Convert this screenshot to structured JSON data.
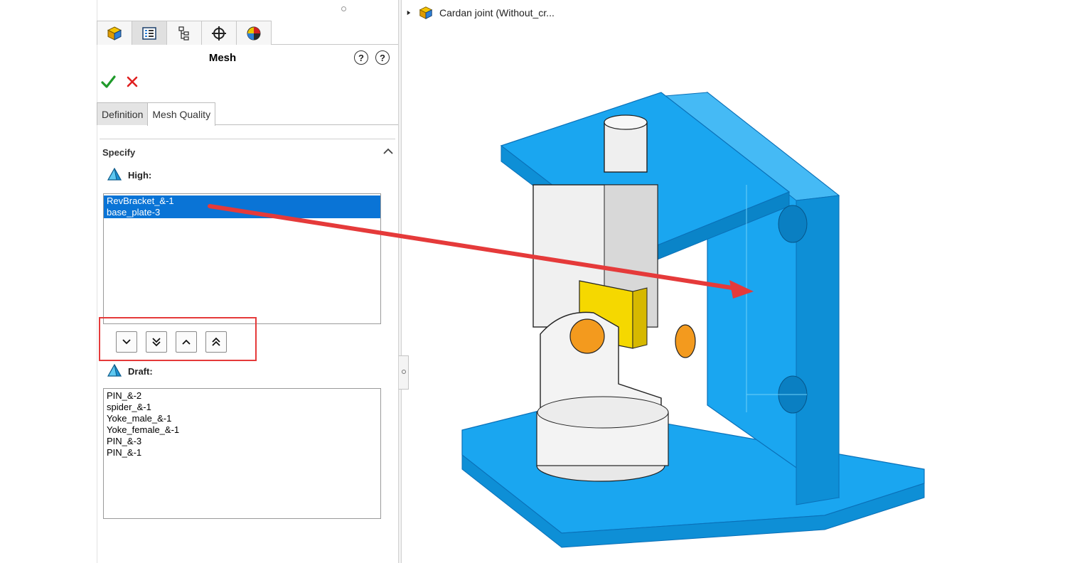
{
  "feature_tree": {
    "node_label": "Cardan joint  (Without_cr..."
  },
  "property_manager": {
    "title": "Mesh",
    "ok_label": "OK",
    "cancel_label": "Cancel"
  },
  "manager_tabs": [
    {
      "icon": "feature-manager-icon"
    },
    {
      "icon": "property-manager-icon"
    },
    {
      "icon": "configuration-manager-icon"
    },
    {
      "icon": "dimxpert-manager-icon"
    },
    {
      "icon": "display-manager-icon"
    }
  ],
  "tabs": [
    {
      "label": "Definition",
      "active": false
    },
    {
      "label": "Mesh Quality",
      "active": true
    }
  ],
  "specify": {
    "label": "Specify",
    "high": {
      "label": "High:",
      "items": [
        "RevBracket_&-1",
        "base_plate-3"
      ]
    },
    "draft": {
      "label": "Draft:",
      "items": [
        "PIN_&-2",
        "spider_&-1",
        "Yoke_male_&-1",
        "Yoke_female_&-1",
        "PIN_&-3",
        "PIN_&-1"
      ]
    },
    "move_buttons": [
      {
        "icon": "chevron-down-icon"
      },
      {
        "icon": "double-chevron-down-icon"
      },
      {
        "icon": "chevron-up-icon"
      },
      {
        "icon": "double-chevron-up-icon"
      }
    ]
  },
  "colors": {
    "high_quality_blue": "#1aa6f0",
    "selection_blue": "#0a74d6",
    "callout_red": "#e53a3a",
    "pin_orange": "#f39a1e",
    "spider_yellow": "#f5d800"
  }
}
